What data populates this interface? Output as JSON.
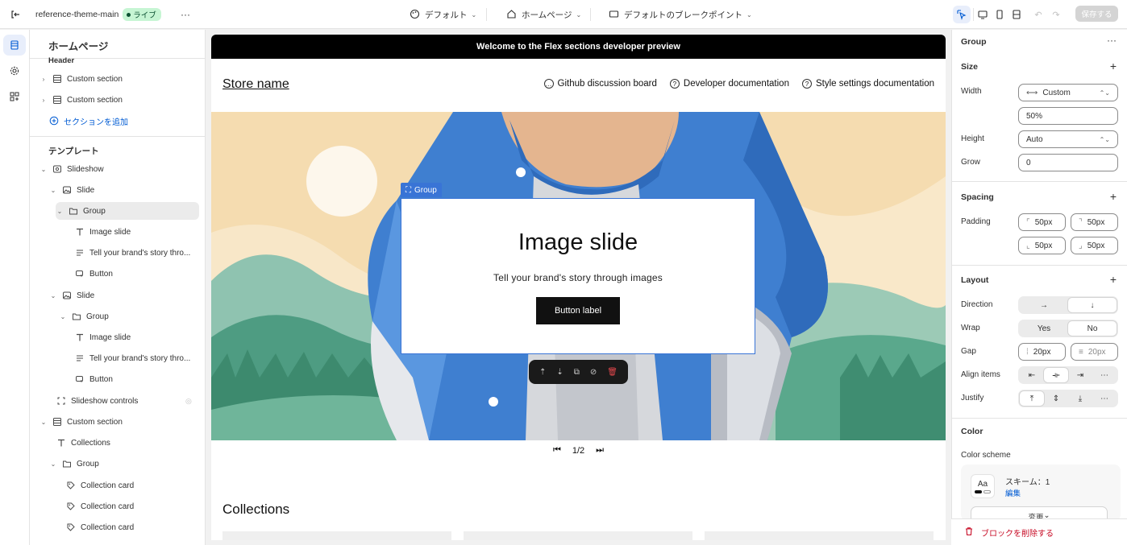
{
  "topbar": {
    "theme_name": "reference-theme-main",
    "live_badge": "ライブ",
    "more": "···",
    "theme_select": "デフォルト",
    "page_select": "ホームページ",
    "breakpoint_select": "デフォルトのブレークポイント",
    "save_label": "保存する"
  },
  "rail": {
    "items": [
      "sections-icon",
      "settings-icon",
      "apps-icon"
    ]
  },
  "sidebar": {
    "title": "ホームページ",
    "header_group": "Header",
    "header_items": [
      "Custom section",
      "Custom section"
    ],
    "add_section": "セクションを追加",
    "template_label": "テンプレート",
    "tree": [
      {
        "label": "Slideshow",
        "icon": "slideshow-icon"
      },
      {
        "label": "Slide",
        "icon": "slide-icon"
      },
      {
        "label": "Group",
        "icon": "folder-icon"
      },
      {
        "label": "Image slide",
        "icon": "text-icon"
      },
      {
        "label": "Tell your brand's story thro...",
        "icon": "paragraph-icon"
      },
      {
        "label": "Button",
        "icon": "button-icon"
      },
      {
        "label": "Slide",
        "icon": "slide-icon"
      },
      {
        "label": "Group",
        "icon": "folder-icon"
      },
      {
        "label": "Image slide",
        "icon": "text-icon"
      },
      {
        "label": "Tell your brand's story thro...",
        "icon": "paragraph-icon"
      },
      {
        "label": "Button",
        "icon": "button-icon"
      },
      {
        "label": "Slideshow controls",
        "icon": "controls-icon"
      },
      {
        "label": "Custom section",
        "icon": "section-icon"
      },
      {
        "label": "Collections",
        "icon": "text-icon"
      },
      {
        "label": "Group",
        "icon": "folder-icon"
      },
      {
        "label": "Collection card",
        "icon": "tag-icon"
      },
      {
        "label": "Collection card",
        "icon": "tag-icon"
      },
      {
        "label": "Collection card",
        "icon": "tag-icon"
      }
    ]
  },
  "preview": {
    "announcement": "Welcome to the Flex sections developer preview",
    "store_name": "Store name",
    "nav_links": [
      "Github discussion board",
      "Developer documentation",
      "Style settings documentation"
    ],
    "group_tag": "Group",
    "slide_title": "Image slide",
    "slide_text": "Tell your brand's story through images",
    "slide_button": "Button label",
    "pager": "1/2",
    "collections_title": "Collections",
    "colors": {
      "accent": "#3974d6",
      "sky": "#f5dcb0",
      "jacket": "#3f7fd0"
    }
  },
  "props": {
    "title": "Group",
    "more": "···",
    "size": {
      "heading": "Size",
      "width_label": "Width",
      "width_mode": "Custom",
      "width_value": "50%",
      "height_label": "Height",
      "height_mode": "Auto",
      "grow_label": "Grow",
      "grow_value": "0"
    },
    "spacing": {
      "heading": "Spacing",
      "padding_label": "Padding",
      "padding": [
        "50px",
        "50px",
        "50px",
        "50px"
      ]
    },
    "layout": {
      "heading": "Layout",
      "direction_label": "Direction",
      "direction_options": [
        "→",
        "↓"
      ],
      "wrap_label": "Wrap",
      "wrap_options": [
        "Yes",
        "No"
      ],
      "gap_label": "Gap",
      "gap_values": [
        "20px",
        "20px"
      ],
      "align_label": "Align items",
      "justify_label": "Justify"
    },
    "color": {
      "heading": "Color",
      "scheme_label": "Color scheme",
      "scheme_sample": "Aa",
      "scheme_name": "スキーム：1",
      "edit_link": "編集",
      "change_button": "変更"
    },
    "delete_block": "ブロックを削除する"
  }
}
